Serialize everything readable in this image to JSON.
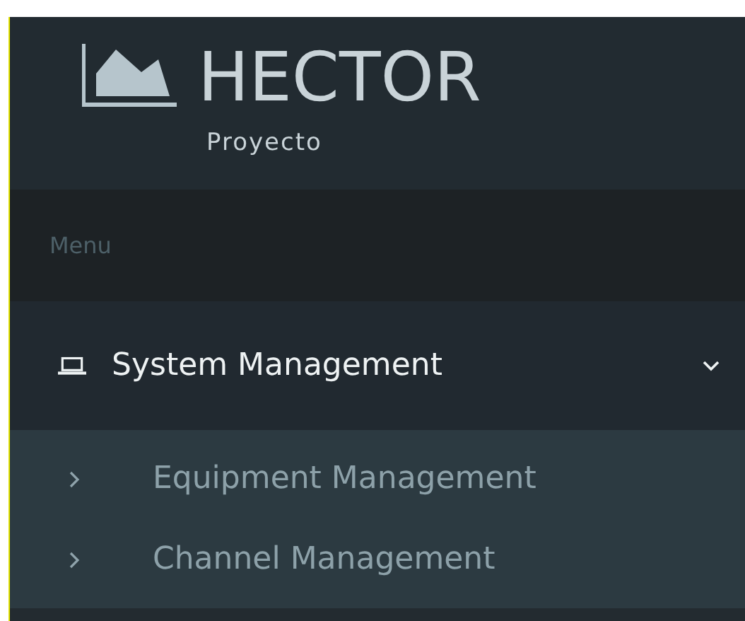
{
  "brand": {
    "title": "HECTOR",
    "subtitle": "Proyecto"
  },
  "menu_label": "Menu",
  "items": [
    {
      "label": "System Management",
      "expanded": true,
      "children": [
        {
          "label": "Equipment Management"
        },
        {
          "label": "Channel Management"
        }
      ]
    }
  ]
}
